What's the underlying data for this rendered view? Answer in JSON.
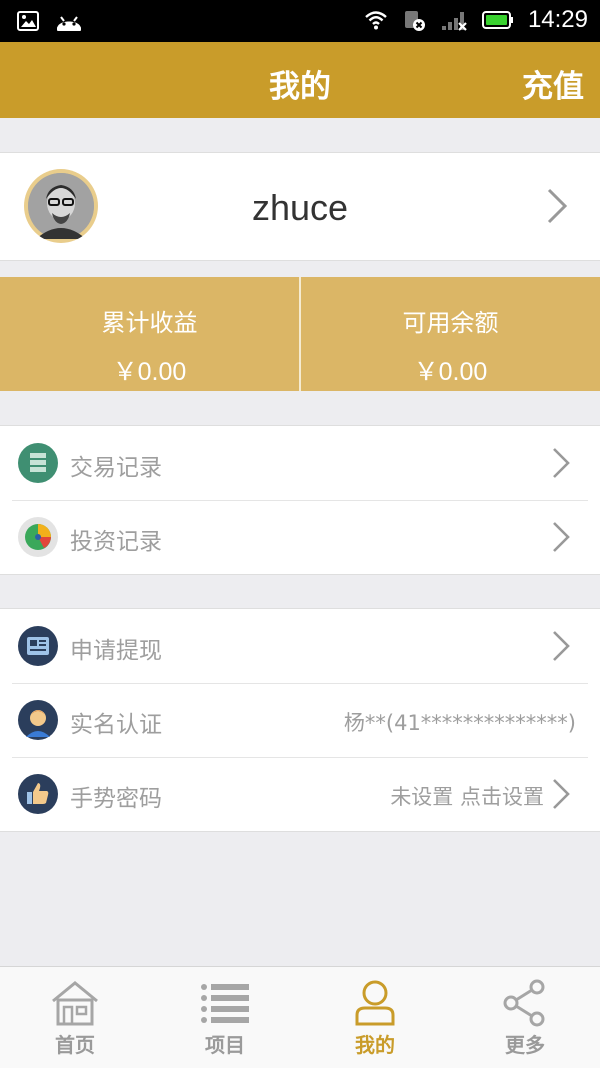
{
  "status_bar": {
    "time": "14:29",
    "icons": [
      "image-icon",
      "android-icon",
      "wifi-icon",
      "sim-off-icon",
      "signal-icon",
      "battery-icon"
    ]
  },
  "header": {
    "title": "我的",
    "action": "充值"
  },
  "profile": {
    "username": "zhuce"
  },
  "stats": [
    {
      "label": "累计收益",
      "value": "￥0.00"
    },
    {
      "label": "可用余额",
      "value": "￥0.00"
    }
  ],
  "group1": [
    {
      "label": "交易记录",
      "icon": "stack-icon"
    },
    {
      "label": "投资记录",
      "icon": "pie-chart-icon"
    }
  ],
  "group2": [
    {
      "label": "申请提现",
      "icon": "card-icon",
      "info": ""
    },
    {
      "label": "实名认证",
      "icon": "person-icon",
      "info": "杨**(41**************)"
    },
    {
      "label": "手势密码",
      "icon": "thumbs-up-icon",
      "info": "未设置  点击设置"
    }
  ],
  "tabs": [
    {
      "label": "首页",
      "icon": "home-icon"
    },
    {
      "label": "项目",
      "icon": "list-icon"
    },
    {
      "label": "我的",
      "icon": "user-icon"
    },
    {
      "label": "更多",
      "icon": "share-icon"
    }
  ],
  "colors": {
    "accent": "#c99c2a",
    "stats_bg": "#dbb666",
    "page_bg": "#ededf0"
  }
}
